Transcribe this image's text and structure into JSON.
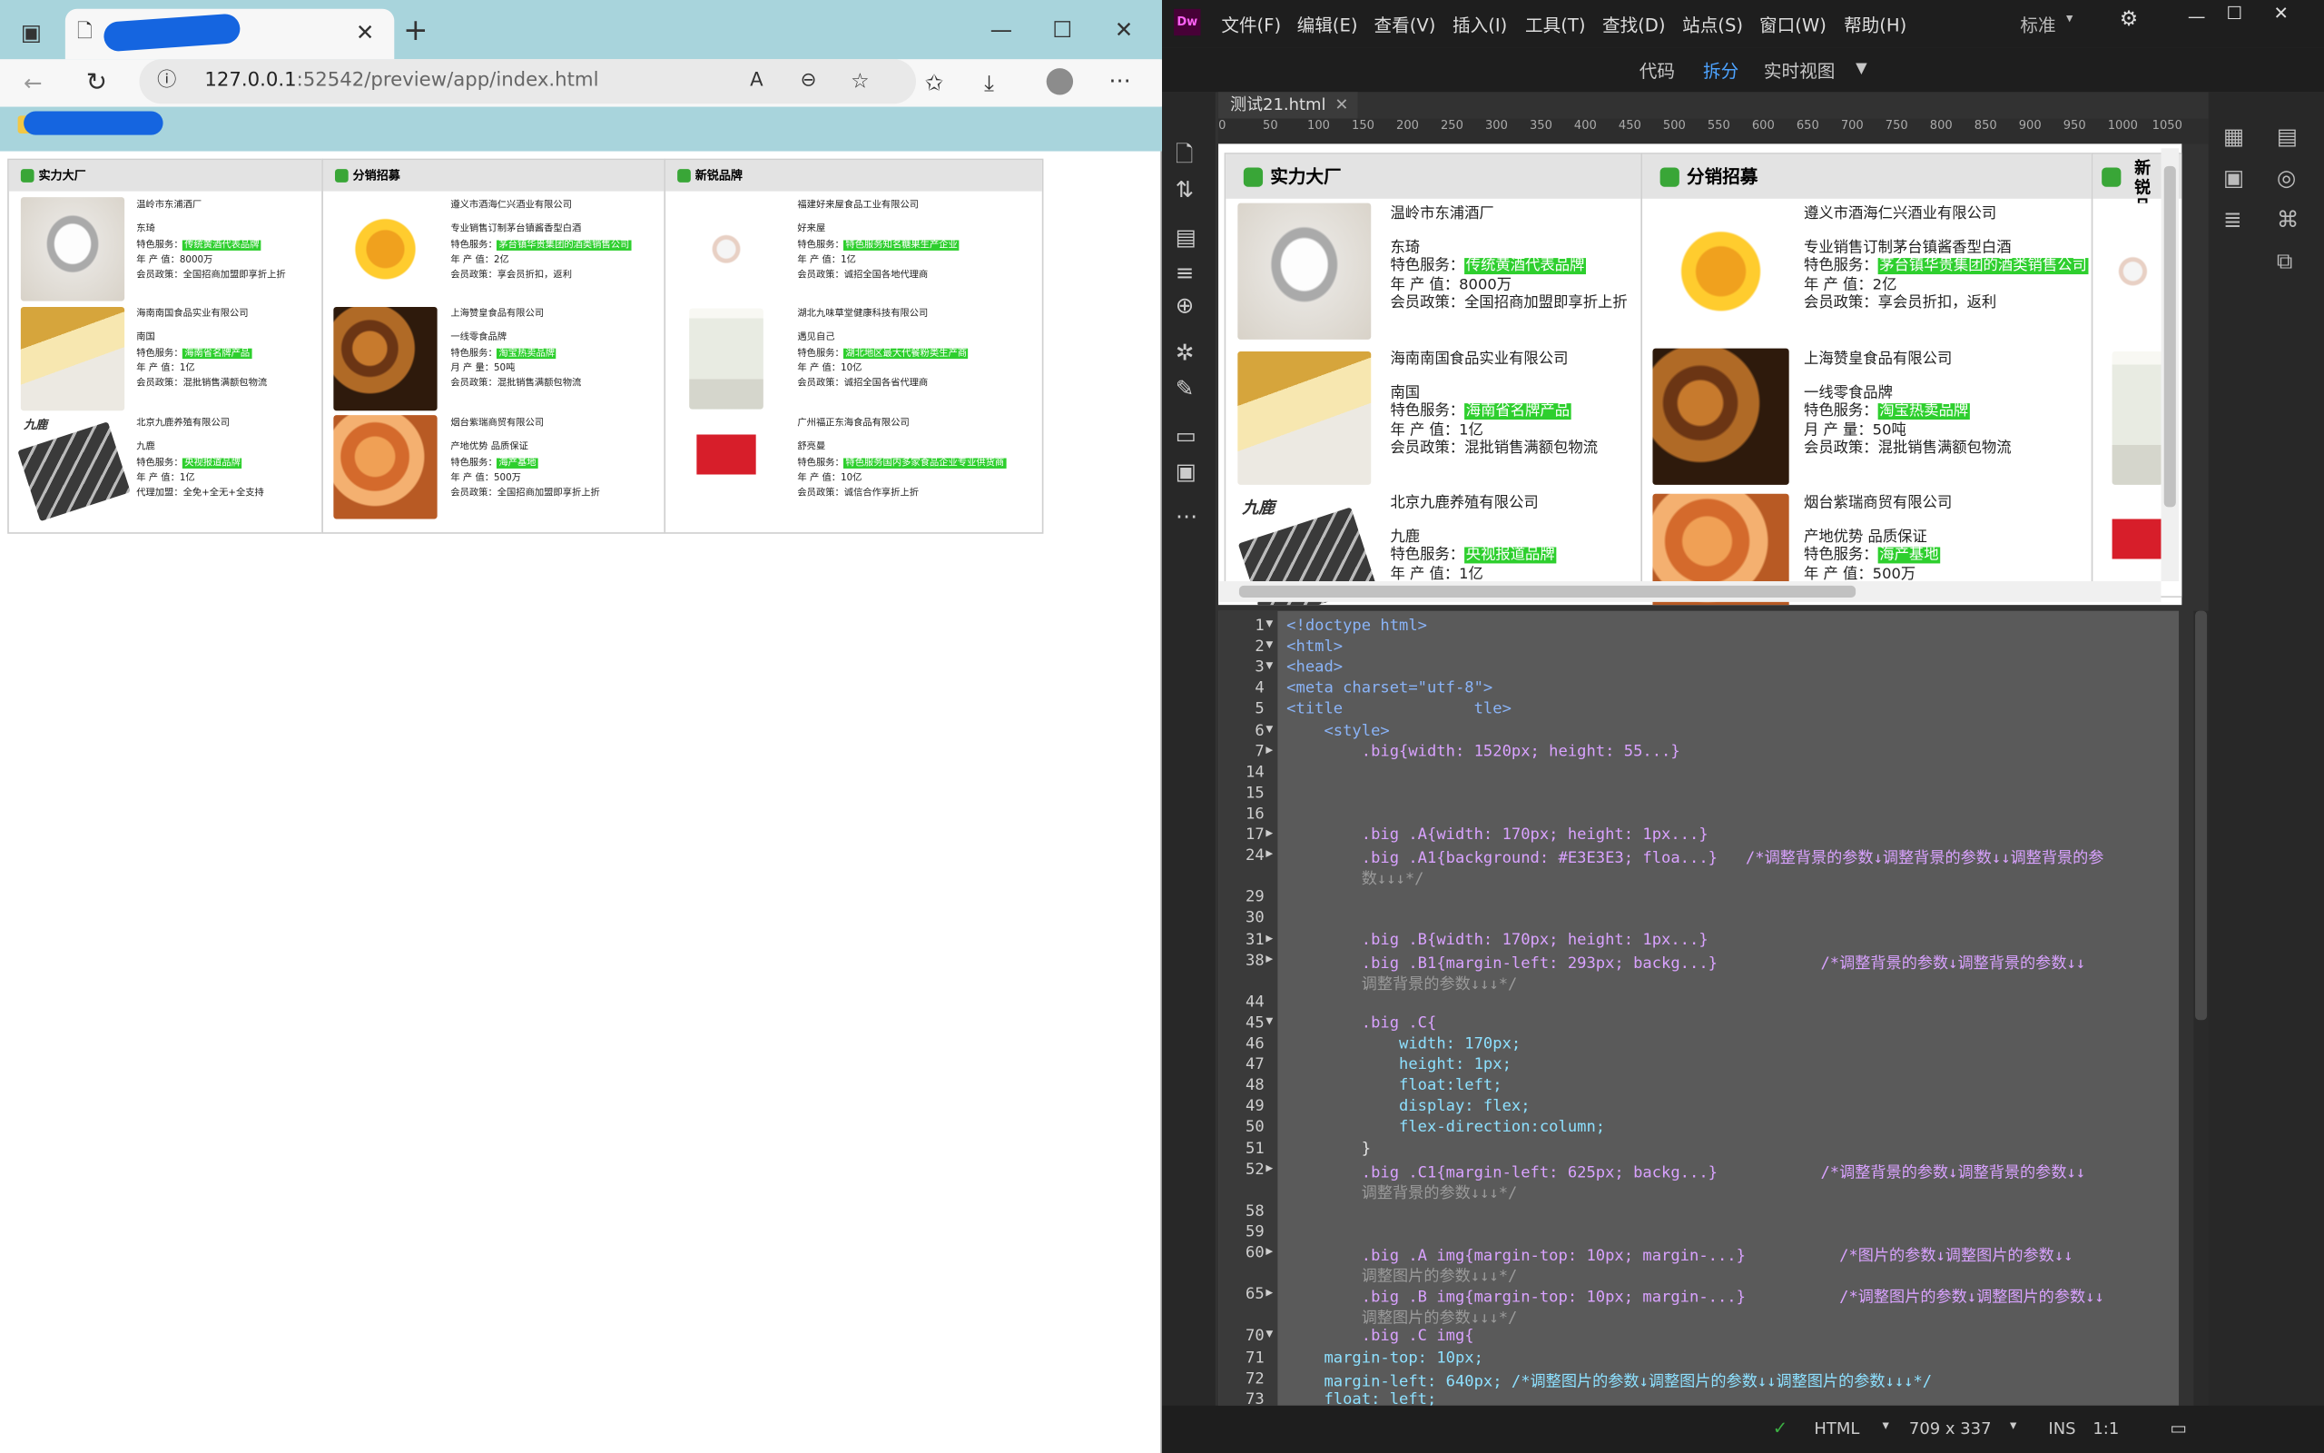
{
  "browser": {
    "url_host": "127.0.0.1",
    "url_rest": ":52542/preview/app/index.html",
    "tab_close": "✕",
    "new_tab": "+"
  },
  "page": {
    "columns": [
      {
        "header": "实力大厂",
        "items": [
          {
            "company": "温岭市东浦酒厂",
            "brand": "东琦",
            "lines": [
              {
                "k": "特色服务：",
                "v": "传统黄酒代表品牌",
                "hl": true
              },
              {
                "k": "年 产 值：",
                "v": "8000万"
              },
              {
                "k": "会员政策：",
                "v": "全国招商加盟即享折上折"
              }
            ]
          },
          {
            "company": "海南南国食品实业有限公司",
            "brand": "南国",
            "lines": [
              {
                "k": "特色服务：",
                "v": "海南省名牌产品",
                "hl": true
              },
              {
                "k": "年 产 值：",
                "v": "1亿"
              },
              {
                "k": "会员政策：",
                "v": "混批销售满额包物流"
              }
            ]
          },
          {
            "company": "北京九鹿养殖有限公司",
            "brand": "九鹿",
            "lines": [
              {
                "k": "特色服务：",
                "v": "央视报道品牌",
                "hl": true
              },
              {
                "k": "年 产 值：",
                "v": "1亿"
              },
              {
                "k": "代理加盟：",
                "v": "全免+全无+全支持"
              }
            ]
          }
        ]
      },
      {
        "header": "分销招募",
        "items": [
          {
            "company": "遵义市酒海仁兴酒业有限公司",
            "brand": "专业销售订制茅台镇酱香型白酒",
            "lines": [
              {
                "k": "特色服务：",
                "v": "茅台镇华贵集团的酒类销售公司",
                "hl": true
              },
              {
                "k": "年 产 值：",
                "v": "2亿"
              },
              {
                "k": "会员政策：",
                "v": "享会员折扣，返利"
              }
            ]
          },
          {
            "company": "上海赞皇食品有限公司",
            "brand": "一线零食品牌",
            "lines": [
              {
                "k": "特色服务：",
                "v": "淘宝热卖品牌",
                "hl": true
              },
              {
                "k": "月 产 量：",
                "v": "50吨"
              },
              {
                "k": "会员政策：",
                "v": "混批销售满额包物流"
              }
            ]
          },
          {
            "company": "烟台紫瑞商贸有限公司",
            "brand": "产地优势 品质保证",
            "lines": [
              {
                "k": "特色服务：",
                "v": "海产基地",
                "hl": true
              },
              {
                "k": "年 产 值：",
                "v": "500万"
              },
              {
                "k": "会员政策：",
                "v": "全国招商加盟即享折上折"
              }
            ]
          }
        ]
      },
      {
        "header": "新锐品牌",
        "items": [
          {
            "company": "福建好来屋食品工业有限公司",
            "brand": "好来屋",
            "lines": [
              {
                "k": "特色服务：",
                "v": "特色服务知名糖果生产企业",
                "hl": true
              },
              {
                "k": "年 产 值：",
                "v": "1亿"
              },
              {
                "k": "会员政策：",
                "v": "诚招全国各地代理商"
              }
            ]
          },
          {
            "company": "湖北九味草堂健康科技有限公司",
            "brand": "遇见自己",
            "lines": [
              {
                "k": "特色服务：",
                "v": "湖北地区最大代餐粉类生产商",
                "hl": true
              },
              {
                "k": "年 产 值：",
                "v": "10亿"
              },
              {
                "k": "会员政策：",
                "v": "诚招全国各省代理商"
              }
            ]
          },
          {
            "company": "广州福正东海食品有限公司",
            "brand": "舒亮曼",
            "lines": [
              {
                "k": "特色服务：",
                "v": "特色服务国内多家食品企业专业供货商",
                "hl": true
              },
              {
                "k": "年 产 值：",
                "v": "10亿"
              },
              {
                "k": "会员政策：",
                "v": "诚信合作享折上折"
              }
            ]
          }
        ]
      }
    ],
    "logo_text": "九鹿"
  },
  "dw": {
    "logo": "Dw",
    "menus": [
      "文件(F)",
      "编辑(E)",
      "查看(V)",
      "插入(I)",
      "工具(T)",
      "查找(D)",
      "站点(S)",
      "窗口(W)",
      "帮助(H)"
    ],
    "workspace": "标准",
    "views": [
      "代码",
      "拆分",
      "实时视图"
    ],
    "doc_tab": "测试21.html",
    "ruler": [
      "0",
      "50",
      "100",
      "150",
      "200",
      "250",
      "300",
      "350",
      "400",
      "450",
      "500",
      "550",
      "600",
      "650",
      "700",
      "750",
      "800",
      "850",
      "900",
      "950",
      "1000",
      "1050"
    ],
    "live_third_header": "新锐品牌",
    "code_lines": [
      {
        "n": "1",
        "t": "<!doctype html>",
        "c": "tag",
        "f": "▼"
      },
      {
        "n": "2",
        "t": "<html>",
        "c": "tag",
        "f": "▼"
      },
      {
        "n": "3",
        "t": "<head>",
        "c": "tag",
        "f": "▼"
      },
      {
        "n": "4",
        "t": "<meta charset=\"utf-8\">",
        "c": "tag",
        "f": ""
      },
      {
        "n": "5",
        "t": "<title              tle>",
        "c": "tag",
        "f": ""
      },
      {
        "n": "6",
        "t": "    <style>",
        "c": "tag",
        "f": "▼"
      },
      {
        "n": "7",
        "t": "        .big{width: 1520px; height: 55...}",
        "c": "sel",
        "f": "▶"
      },
      {
        "n": "14",
        "t": "",
        "c": "",
        "f": ""
      },
      {
        "n": "15",
        "t": "",
        "c": "",
        "f": ""
      },
      {
        "n": "16",
        "t": "",
        "c": "",
        "f": ""
      },
      {
        "n": "17",
        "t": "        .big .A{width: 170px; height: 1px...}",
        "c": "sel",
        "f": "▶"
      },
      {
        "n": "24",
        "t": "        .big .A1{background: #E3E3E3; floa...}   /*调整背景的参数↓调整背景的参数↓↓调整背景的参",
        "c": "sel",
        "f": "▶"
      },
      {
        "n": "",
        "t": "        数↓↓↓*/",
        "c": "cm",
        "f": ""
      },
      {
        "n": "29",
        "t": "",
        "c": "",
        "f": ""
      },
      {
        "n": "30",
        "t": "",
        "c": "",
        "f": ""
      },
      {
        "n": "31",
        "t": "        .big .B{width: 170px; height: 1px...}",
        "c": "sel",
        "f": "▶"
      },
      {
        "n": "38",
        "t": "        .big .B1{margin-left: 293px; backg...}           /*调整背景的参数↓调整背景的参数↓↓",
        "c": "sel",
        "f": "▶"
      },
      {
        "n": "",
        "t": "        调整背景的参数↓↓↓*/",
        "c": "cm",
        "f": ""
      },
      {
        "n": "44",
        "t": "",
        "c": "",
        "f": ""
      },
      {
        "n": "45",
        "t": "        .big .C{",
        "c": "sel",
        "f": "▼"
      },
      {
        "n": "46",
        "t": "            width: 170px;",
        "c": "prop",
        "f": ""
      },
      {
        "n": "47",
        "t": "            height: 1px;",
        "c": "prop",
        "f": ""
      },
      {
        "n": "48",
        "t": "            float:left;",
        "c": "prop",
        "f": ""
      },
      {
        "n": "49",
        "t": "            display: flex;",
        "c": "prop",
        "f": ""
      },
      {
        "n": "50",
        "t": "            flex-direction:column;",
        "c": "prop",
        "f": ""
      },
      {
        "n": "51",
        "t": "        }",
        "c": "",
        "f": ""
      },
      {
        "n": "52",
        "t": "        .big .C1{margin-left: 625px; backg...}           /*调整背景的参数↓调整背景的参数↓↓",
        "c": "sel",
        "f": "▶"
      },
      {
        "n": "",
        "t": "        调整背景的参数↓↓↓*/",
        "c": "cm",
        "f": ""
      },
      {
        "n": "58",
        "t": "",
        "c": "",
        "f": ""
      },
      {
        "n": "59",
        "t": "",
        "c": "",
        "f": ""
      },
      {
        "n": "60",
        "t": "        .big .A img{margin-top: 10px; margin-...}          /*图片的参数↓调整图片的参数↓↓",
        "c": "sel",
        "f": "▶"
      },
      {
        "n": "",
        "t": "        调整图片的参数↓↓↓*/",
        "c": "cm",
        "f": ""
      },
      {
        "n": "65",
        "t": "        .big .B img{margin-top: 10px; margin-...}          /*调整图片的参数↓调整图片的参数↓↓",
        "c": "sel",
        "f": "▶"
      },
      {
        "n": "",
        "t": "        调整图片的参数↓↓↓*/",
        "c": "cm",
        "f": ""
      },
      {
        "n": "70",
        "t": "        .big .C img{",
        "c": "sel",
        "f": "▼"
      },
      {
        "n": "71",
        "t": "    margin-top: 10px;",
        "c": "prop",
        "f": ""
      },
      {
        "n": "72",
        "t": "    margin-left: 640px; /*调整图片的参数↓调整图片的参数↓↓调整图片的参数↓↓↓*/",
        "c": "prop",
        "f": ""
      },
      {
        "n": "73",
        "t": "    float: left;",
        "c": "prop",
        "f": ""
      }
    ],
    "status": {
      "lang": "HTML",
      "size": "709 x 337",
      "mode": "INS",
      "pos": "1:1"
    }
  }
}
